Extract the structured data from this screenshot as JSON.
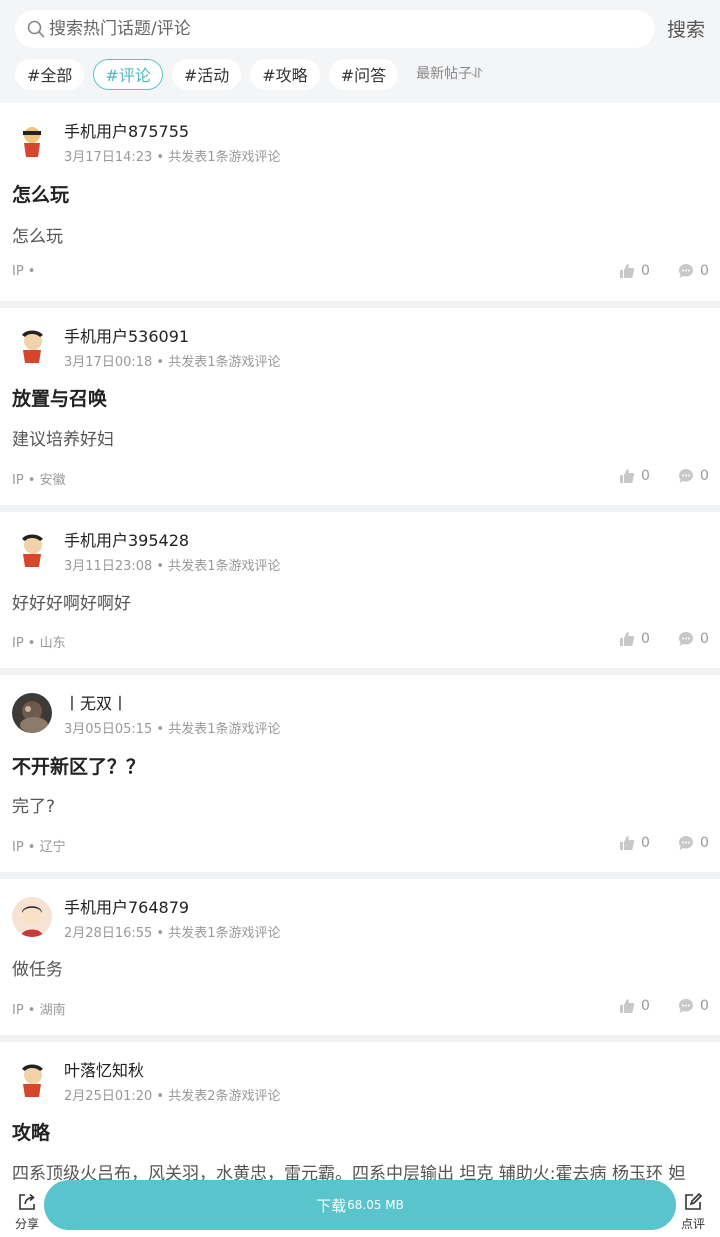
{
  "search": {
    "placeholder": "搜索热门话题/评论",
    "button_label": "搜索"
  },
  "tags": [
    "#全部",
    "#评论",
    "#活动",
    "#攻略",
    "#问答"
  ],
  "active_tag_index": 1,
  "sort_label": "最新帖子⥯",
  "posts": [
    {
      "user": "手机用户875755",
      "time": "3月17日14:23",
      "meta_suffix": "• 共发表1条游戏评论",
      "title": "怎么玩",
      "body": "怎么玩",
      "ip": "IP •",
      "likes": "0",
      "comments": "0"
    },
    {
      "user": "手机用户536091",
      "time": "3月17日00:18",
      "meta_suffix": "• 共发表1条游戏评论",
      "title": "放置与召唤",
      "body": "建议培养好妇",
      "ip": "IP • 安徽",
      "likes": "0",
      "comments": "0"
    },
    {
      "user": "手机用户395428",
      "time": "3月11日23:08",
      "meta_suffix": "• 共发表1条游戏评论",
      "title": "",
      "body": "好好好啊好啊好",
      "ip": "IP • 山东",
      "likes": "0",
      "comments": "0"
    },
    {
      "user": "丨无双丨",
      "time": "3月05日05:15",
      "meta_suffix": "• 共发表1条游戏评论",
      "title": "不开新区了？？",
      "body": "完了?",
      "ip": "IP • 辽宁",
      "likes": "0",
      "comments": "0"
    },
    {
      "user": "手机用户764879",
      "time": "2月28日16:55",
      "meta_suffix": "• 共发表1条游戏评论",
      "title": "",
      "body": "做任务",
      "ip": "IP • 湖南",
      "likes": "0",
      "comments": "0"
    },
    {
      "user": "叶落忆知秋",
      "time": "2月25日01:20",
      "meta_suffix": "• 共发表2条游戏评论",
      "title": "攻略",
      "body": "四系顶级火吕布，风关羽，水黄忠，雷元霸。四系中层输出 坦克 辅助火:霍去病 杨玉环 妲",
      "ip": "",
      "likes": "",
      "comments": ""
    }
  ],
  "bottom": {
    "share_label": "分享",
    "download_label": "下载",
    "download_size": "68.05 MB",
    "review_label": "点评"
  },
  "colors": {
    "accent": "#59c4cb",
    "background": "#f4f5f7"
  },
  "icons": {
    "search": "search-icon",
    "like": "thumb-up-icon",
    "comment": "comment-bubble-icon",
    "share": "share-icon",
    "review": "edit-icon"
  }
}
